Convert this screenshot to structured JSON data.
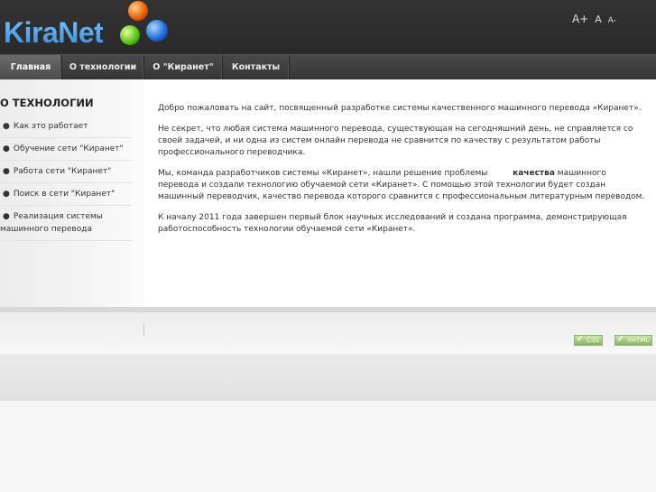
{
  "header": {
    "logo_text": "KiraNet",
    "font_sizes": [
      "A+",
      "A",
      "A-"
    ]
  },
  "nav": {
    "items": [
      "Главная",
      "О технологии",
      "О \"Киранет\"",
      "Контакты"
    ],
    "active": "Главная"
  },
  "sidebar": {
    "title": "О ТЕХНОЛОГИИ",
    "items": [
      "Как это работает",
      "Обучение сети \"Киранет\"",
      "Работа сети \"Киранет\"",
      "Поиск в сети \"Киранет\"",
      "Реализация системы",
      "машинного перевода"
    ]
  },
  "main": {
    "p1": "Добро пожаловать на сайт, посвященный разработке системы качественного машинного перевода «Киранет».",
    "p2": "Не секрет, что любая система машинного перевода, существующая на сегодняшний день, не справляется со своей задачей, и ни одна из систем онлайн перевода не сравнится по качеству с результатом работы профессионального переводчика.",
    "p3a": "Мы, команда разработчиков системы «Киранет», нашли решение проблемы",
    "p3b": "качества",
    "p3c": "машинного перевода и создали технологию обучаемой сети «Киранет». С помощью этой технологии будет создан машинный переводчик, качество перевода которого сравнится с профессиональным литературным переводом.",
    "p4": "К началу   2011 года завершен первый блок научных исследований и создана программа, демонстрирующая работоспособность технологии обучаемой сети «Киранет»."
  },
  "footer": {
    "badges": [
      "CSS",
      "XHTML"
    ]
  }
}
